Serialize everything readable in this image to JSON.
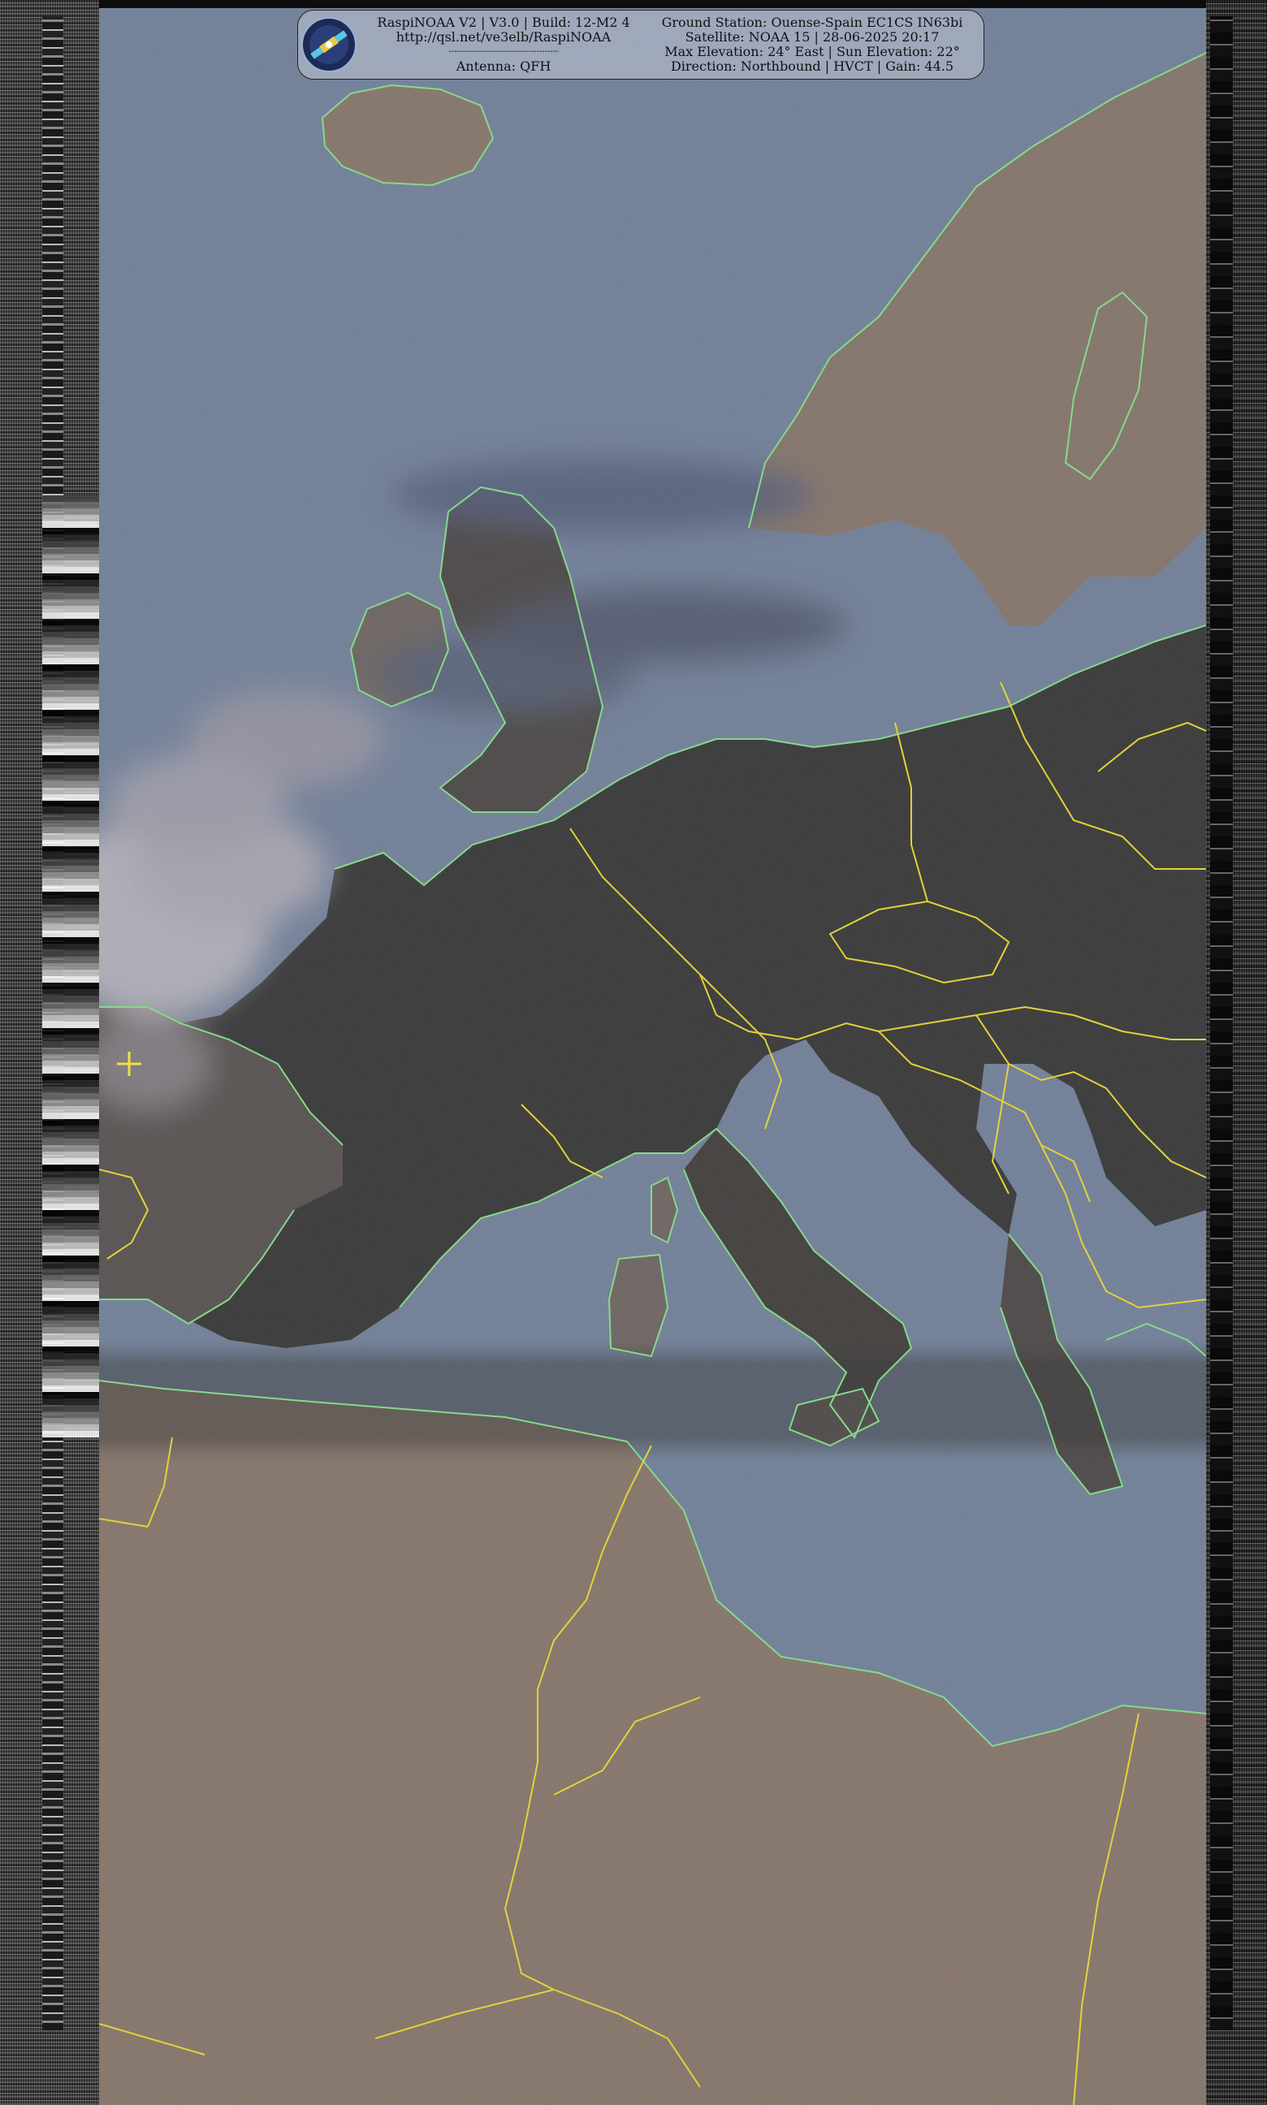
{
  "header": {
    "left": {
      "line1": "RaspiNOAA V2 | V3.0 | Build: 12-M2 4",
      "line2": "http://qsl.net/ve3elb/RaspiNOAA",
      "line3": "----------------------------------------",
      "line4": "Antenna: QFH"
    },
    "right": {
      "line1": "Ground Station: Ouense-Spain EC1CS  IN63bi",
      "line2": "Satellite: NOAA 15 | 28-06-2025 20:17",
      "line3": "Max Elevation: 24° East | Sun Elevation: 22°",
      "line4": "Direction: Northbound | HVCT | Gain: 44.5"
    }
  },
  "colors": {
    "sea": "#6f84a8",
    "land": "#8a7466",
    "dark_land": "#1c1c1c",
    "coastline": "#86d98a",
    "borders": "#e2d23a",
    "cloud": "#c9c3cf"
  },
  "icons": {
    "logo": "raspinoaa-satellite-logo",
    "station_marker": "crosshair-icon"
  }
}
